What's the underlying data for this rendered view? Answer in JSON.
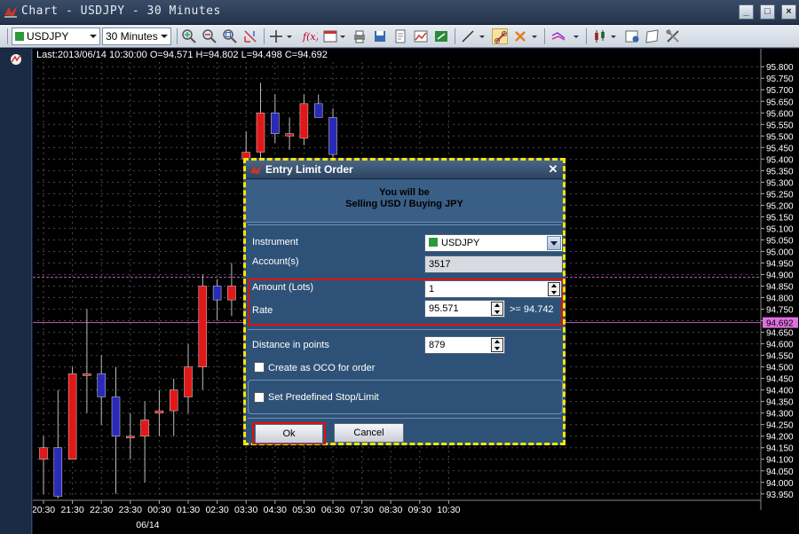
{
  "window": {
    "title": "Chart - USDJPY - 30 Minutes"
  },
  "toolbar": {
    "instrument": "USDJPY",
    "timeframe": "30 Minutes"
  },
  "chart": {
    "info": "Last:2013/06/14 10:30:00 O=94.571 H=94.802 L=94.498 C=94.692",
    "current_price_label": "94.692",
    "date_label": "06/14"
  },
  "chart_data": {
    "type": "candlestick",
    "title": "",
    "price_ticks": [
      "95.800",
      "95.750",
      "95.700",
      "95.650",
      "95.600",
      "95.550",
      "95.500",
      "95.450",
      "95.400",
      "95.350",
      "95.300",
      "95.250",
      "95.200",
      "95.150",
      "95.100",
      "95.050",
      "95.000",
      "94.950",
      "94.900",
      "94.850",
      "94.800",
      "94.750",
      "94.700",
      "94.650",
      "94.600",
      "94.550",
      "94.500",
      "94.450",
      "94.400",
      "94.350",
      "94.300",
      "94.250",
      "94.200",
      "94.150",
      "94.100",
      "94.050",
      "94.000",
      "93.950"
    ],
    "time_ticks": [
      "20:30",
      "21:30",
      "22:30",
      "23:30",
      "00:30",
      "01:30",
      "02:30",
      "03:30",
      "04:30",
      "05:30",
      "06:30",
      "07:30",
      "08:30",
      "09:30",
      "10:30"
    ],
    "ylim": [
      93.93,
      95.82
    ],
    "horizontal_lines": [
      94.888,
      94.692
    ],
    "candles": [
      {
        "o": 94.1,
        "h": 94.2,
        "l": 93.95,
        "c": 94.15
      },
      {
        "o": 94.15,
        "h": 94.4,
        "l": 93.93,
        "c": 93.94
      },
      {
        "o": 94.1,
        "h": 94.5,
        "l": 94.1,
        "c": 94.47
      },
      {
        "o": 94.47,
        "h": 94.75,
        "l": 94.3,
        "c": 94.47
      },
      {
        "o": 94.47,
        "h": 94.55,
        "l": 94.25,
        "c": 94.37
      },
      {
        "o": 94.37,
        "h": 94.5,
        "l": 93.95,
        "c": 94.2
      },
      {
        "o": 94.2,
        "h": 94.3,
        "l": 94.1,
        "c": 94.2
      },
      {
        "o": 94.2,
        "h": 94.35,
        "l": 94.0,
        "c": 94.27
      },
      {
        "o": 94.3,
        "h": 94.4,
        "l": 94.2,
        "c": 94.31
      },
      {
        "o": 94.31,
        "h": 94.45,
        "l": 94.2,
        "c": 94.4
      },
      {
        "o": 94.37,
        "h": 94.6,
        "l": 94.3,
        "c": 94.5
      },
      {
        "o": 94.5,
        "h": 94.9,
        "l": 94.4,
        "c": 94.85
      },
      {
        "o": 94.85,
        "h": 94.88,
        "l": 94.7,
        "c": 94.79
      },
      {
        "o": 94.79,
        "h": 94.95,
        "l": 94.72,
        "c": 94.85
      },
      {
        "o": 95.4,
        "h": 95.52,
        "l": 95.37,
        "c": 95.43
      },
      {
        "o": 95.43,
        "h": 95.73,
        "l": 95.4,
        "c": 95.6
      },
      {
        "o": 95.6,
        "h": 95.68,
        "l": 95.47,
        "c": 95.51
      },
      {
        "o": 95.5,
        "h": 95.58,
        "l": 95.44,
        "c": 95.51
      },
      {
        "o": 95.49,
        "h": 95.68,
        "l": 95.46,
        "c": 95.64
      },
      {
        "o": 95.64,
        "h": 95.68,
        "l": 95.58,
        "c": 95.58
      },
      {
        "o": 95.58,
        "h": 95.62,
        "l": 95.4,
        "c": 95.42
      }
    ]
  },
  "dialog": {
    "title": "Entry Limit Order",
    "summary_line1": "You will be",
    "summary_line2": "Selling USD / Buying JPY",
    "instrument_label": "Instrument",
    "instrument_value": "USDJPY",
    "account_label": "Account(s)",
    "account_value": "3517",
    "amount_label": "Amount (Lots)",
    "amount_value": "1",
    "rate_label": "Rate",
    "rate_value": "95.571",
    "rate_hint": ">= 94.742",
    "distance_label": "Distance in points",
    "distance_value": "879",
    "oco_label": "Create as OCO for order",
    "stoplimit_label": "Set Predefined Stop/Limit",
    "ok_label": "Ok",
    "cancel_label": "Cancel"
  },
  "colors": {
    "bull": "#e01818",
    "bear": "#2a2ab8",
    "grid": "#4a4a4a",
    "highlight": "#e01010",
    "dialog_border": "#ffe500"
  }
}
